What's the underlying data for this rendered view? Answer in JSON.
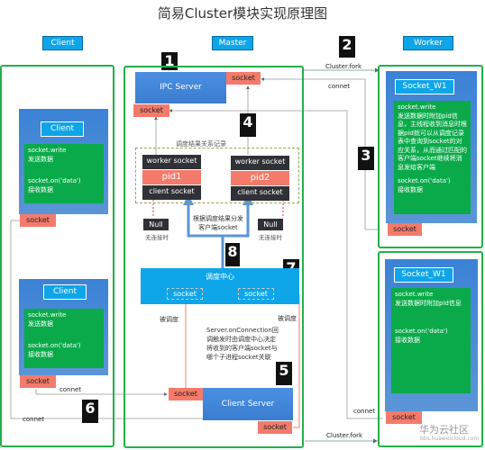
{
  "title": "简易Cluster模块实现原理图",
  "columns": {
    "client": "Client",
    "master": "Master",
    "worker": "Worker"
  },
  "steps": [
    "1",
    "2",
    "3",
    "4",
    "5",
    "6",
    "7",
    "8"
  ],
  "client_box": {
    "label": "Client",
    "write": "socket.write",
    "write_desc": "发送数据",
    "on_data": "socket.on('data')",
    "on_data_desc": "接收数据",
    "socket": "socket"
  },
  "master": {
    "ipc_server": "IPC Server",
    "socket": "socket",
    "record_title": "调度结果关系记录",
    "records": [
      {
        "worker": "worker socket",
        "pid": "pid1",
        "client": "client socket",
        "null": "Null",
        "null_note": "无连接时"
      },
      {
        "worker": "worker socket",
        "pid": "pid2",
        "client": "client socket",
        "null": "Null",
        "null_note": "无连接时"
      }
    ],
    "dispatch_note": "根据调度结果分发客户端socket",
    "scheduler": "调度中心",
    "scheduled": "被调度",
    "on_connection_note": "Server.onConnection回调触发时由调度中心决定将收到的客户端socket与哪个子进程socket关联",
    "client_server": "Client Server"
  },
  "worker1": {
    "label": "Socket_W1",
    "write": "socket.write",
    "write_desc": "发送数据时附加pid信息，主线程收到消息时根据pid就可以从调度记录表中查询到socket的对应关系，从而通过匹配的客户端socket继续将消息发给客户端",
    "on_data": "socket.on('data')",
    "on_data_desc": "接收数据",
    "socket": "socket"
  },
  "worker2": {
    "label": "Socket_W1",
    "write": "socket.write",
    "write_desc": "发送数据时附加pid信息",
    "on_data": "socket.on('data')",
    "on_data_desc": "接收数据",
    "socket": "socket"
  },
  "edges": {
    "cluster_fork": "Cluster.fork",
    "connet": "connet"
  },
  "watermark": {
    "main": "华为云社区",
    "sub": "bbs.huaweicloud.com"
  }
}
